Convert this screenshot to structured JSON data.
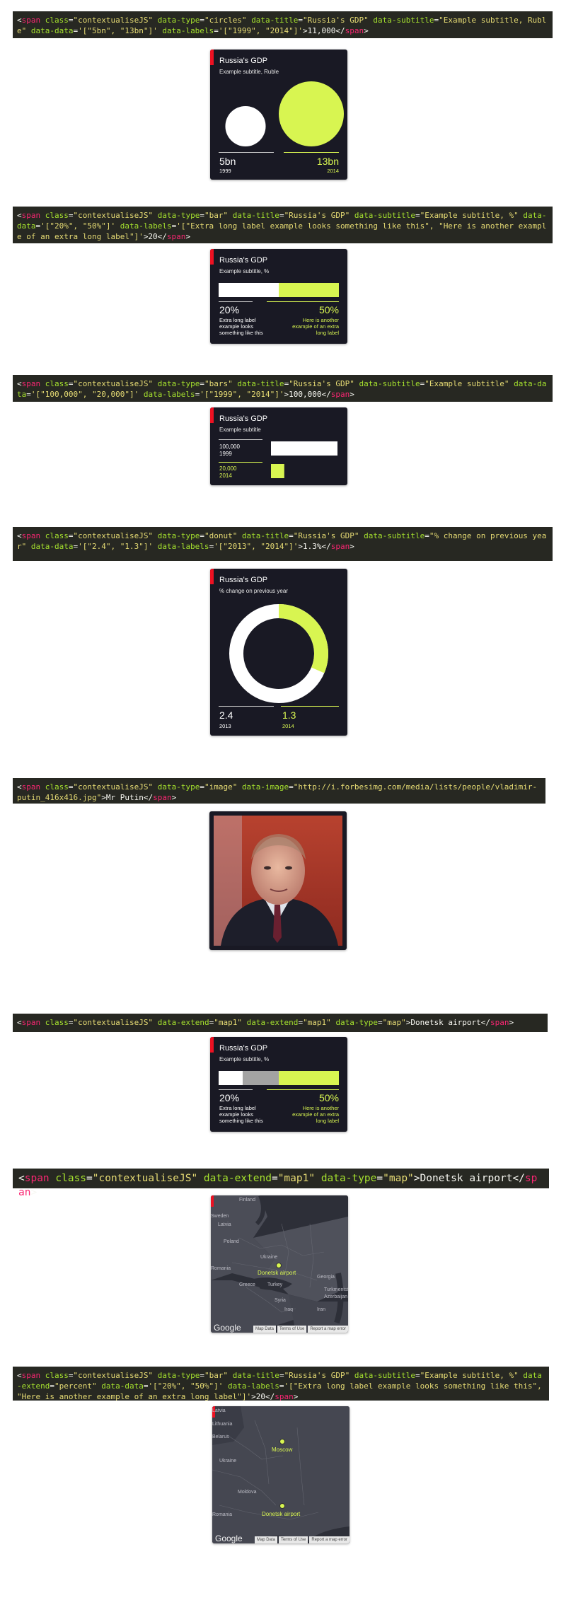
{
  "snippets": [
    {
      "pre": "<",
      "tag": "span",
      "attrs": [
        [
          "class",
          "\"contextualiseJS\""
        ],
        [
          "data-type",
          "\"circles\""
        ],
        [
          "data-title",
          "\"Russia's GDP\""
        ],
        [
          "data-subtitle",
          "\"Example subtitle, Ruble\""
        ],
        [
          "data-data",
          "'[\"5bn\", \"13bn\"]'"
        ],
        [
          "data-labels",
          "'[\"1999\", \"2014\"]'"
        ]
      ],
      "inner": ">11,000</",
      "close": "span",
      "end": ">"
    },
    {
      "pre": "<",
      "tag": "span",
      "attrs": [
        [
          "class",
          "\"contextualiseJS\""
        ],
        [
          "data-type",
          "\"bar\""
        ],
        [
          "data-title",
          "\"Russia's GDP\""
        ],
        [
          "data-subtitle",
          "\"Example subtitle, %\""
        ],
        [
          "data-data",
          "'[\"20%\", \"50%\"]'"
        ],
        [
          "data-labels",
          "'[\"Extra long label example looks something like this\", \"Here is another example of an extra long label\"]'"
        ]
      ],
      "inner": ">20</",
      "close": "span",
      "end": ">"
    },
    {
      "pre": "<",
      "tag": "span",
      "attrs": [
        [
          "class",
          "\"contextualiseJS\""
        ],
        [
          "data-type",
          "\"bars\""
        ],
        [
          "data-title",
          "\"Russia's GDP\""
        ],
        [
          "data-subtitle",
          "\"Example subtitle\""
        ],
        [
          "data-data",
          "'[\"100,000\", \"20,000\"]'"
        ],
        [
          "data-labels",
          "'[\"1999\", \"2014\"]'"
        ]
      ],
      "inner": ">100,000</",
      "close": "span",
      "end": ">"
    },
    {
      "pre": "<",
      "tag": "span",
      "attrs": [
        [
          "class",
          "\"contextualiseJS\""
        ],
        [
          "data-type",
          "\"donut\""
        ],
        [
          "data-title",
          "\"Russia's GDP\""
        ],
        [
          "data-subtitle",
          "\"% change on previous year\""
        ],
        [
          "data-data",
          "'[\"2.4\", \"1.3\"]'"
        ],
        [
          "data-labels",
          "'[\"2013\", \"2014\"]'"
        ]
      ],
      "inner": ">1.3%</",
      "close": "span",
      "end": ">"
    },
    {
      "pre": "<",
      "tag": "span",
      "attrs": [
        [
          "class",
          "\"contextualiseJS\""
        ],
        [
          "data-type",
          "\"image\""
        ],
        [
          "data-image",
          "\"http://i.forbesimg.com/media/lists/people/vladimir-putin_416x416.jpg\""
        ]
      ],
      "inner": ">Mr Putin</",
      "close": "span",
      "end": ">"
    },
    {
      "pre": "<",
      "tag": "span",
      "attrs": [
        [
          "class",
          "\"contextualiseJS\""
        ],
        [
          "data-extend",
          "\"map1\""
        ],
        [
          "data-extend",
          "\"map1\""
        ],
        [
          "data-type",
          "\"map\""
        ]
      ],
      "inner": ">Donetsk airport</",
      "close": "span",
      "end": ">"
    },
    {
      "pre": "<",
      "tag": "span",
      "attrs": [
        [
          "class",
          "\"contextualiseJS\""
        ],
        [
          "data-extend",
          "\"map1\""
        ],
        [
          "data-type",
          "\"map\""
        ]
      ],
      "inner": ">Donetsk airport</",
      "close": "span",
      "end": ">"
    },
    {
      "pre": "<",
      "tag": "span",
      "attrs": [
        [
          "class",
          "\"contextualiseJS\""
        ],
        [
          "data-type",
          "\"bar\""
        ],
        [
          "data-title",
          "\"Russia's GDP\""
        ],
        [
          "data-subtitle",
          "\"Example subtitle, %\""
        ],
        [
          "data-extend",
          "\"percent\""
        ],
        [
          "data-data",
          "'[\"20%\", \"50%\"]'"
        ],
        [
          "data-labels",
          "'[\"Extra long label example looks something like this\", \"Here is another example of an extra long label\"]'"
        ]
      ],
      "inner": ">20</",
      "close": "span",
      "end": ">"
    }
  ],
  "colors": {
    "card_bg": "#191924",
    "accent": "#d8f551",
    "flag": "#ee1122",
    "code_bg": "#272822"
  },
  "card_circles": {
    "title": "Russia's GDP",
    "subtitle": "Example subtitle, Ruble",
    "v1": "5bn",
    "l1": "1999",
    "v2": "13bn",
    "l2": "2014"
  },
  "card_bar": {
    "title": "Russia's GDP",
    "subtitle": "Example subtitle, %",
    "v1": "20%",
    "l1": "Extra long label example looks something like this",
    "v2": "50%",
    "l2": "Here is another example of an extra long label"
  },
  "card_bars": {
    "title": "Russia's GDP",
    "subtitle": "Example subtitle",
    "v1": "100,000",
    "l1": "1999",
    "v2": "20,000",
    "l2": "2014"
  },
  "card_donut": {
    "title": "Russia's GDP",
    "subtitle": "% change on previous year",
    "v1": "2.4",
    "l1": "2013",
    "v2": "1.3",
    "l2": "2014"
  },
  "card_image": {
    "alt": "Mr Putin",
    "icon": "portrait-photo"
  },
  "card_bar2": {
    "title": "Russia's GDP",
    "subtitle": "Example subtitle, %",
    "v1": "20%",
    "l1": "Extra long label example looks something like this",
    "v2": "50%",
    "l2": "Here is another example of an extra long label"
  },
  "map1": {
    "marker": "Donetsk airport",
    "countries": [
      "Finland",
      "Sweden",
      "Latvia",
      "Poland",
      "Ukraine",
      "Romania",
      "Greece",
      "Turkey",
      "Syria",
      "Iraq",
      "Iran",
      "Georgia",
      "Turkmenistan",
      "Azerbaijan"
    ],
    "footer": [
      "Map Data",
      "Terms of Use",
      "Report a map error"
    ],
    "logo": "Google"
  },
  "map2": {
    "markers": [
      "Moscow",
      "Donetsk airport"
    ],
    "countries": [
      "Latvia",
      "Lithuania",
      "Belarus",
      "Ukraine",
      "Moldova",
      "Romania"
    ],
    "footer": [
      "Map Data",
      "Terms of Use",
      "Report a map error"
    ],
    "logo": "Google"
  },
  "chart_data": [
    {
      "type": "circles",
      "title": "Russia's GDP",
      "subtitle": "Example subtitle, Ruble",
      "categories": [
        "1999",
        "2014"
      ],
      "values": [
        5,
        13
      ],
      "value_labels": [
        "5bn",
        "13bn"
      ]
    },
    {
      "type": "bar",
      "title": "Russia's GDP",
      "subtitle": "Example subtitle, %",
      "categories": [
        "Extra long label example looks something like this",
        "Here is another example of an extra long label"
      ],
      "values": [
        20,
        50
      ],
      "value_labels": [
        "20%",
        "50%"
      ]
    },
    {
      "type": "bar",
      "title": "Russia's GDP",
      "subtitle": "Example subtitle",
      "categories": [
        "1999",
        "2014"
      ],
      "values": [
        100000,
        20000
      ],
      "value_labels": [
        "100,000",
        "20,000"
      ]
    },
    {
      "type": "donut",
      "title": "Russia's GDP",
      "subtitle": "% change on previous year",
      "categories": [
        "2013",
        "2014"
      ],
      "values": [
        2.4,
        1.3
      ],
      "value_labels": [
        "2.4",
        "1.3"
      ]
    },
    {
      "type": "bar",
      "title": "Russia's GDP",
      "subtitle": "Example subtitle, %",
      "categories": [
        "Extra long label example looks something like this",
        "Here is another example of an extra long label"
      ],
      "values": [
        20,
        50
      ],
      "value_labels": [
        "20%",
        "50%"
      ]
    }
  ]
}
